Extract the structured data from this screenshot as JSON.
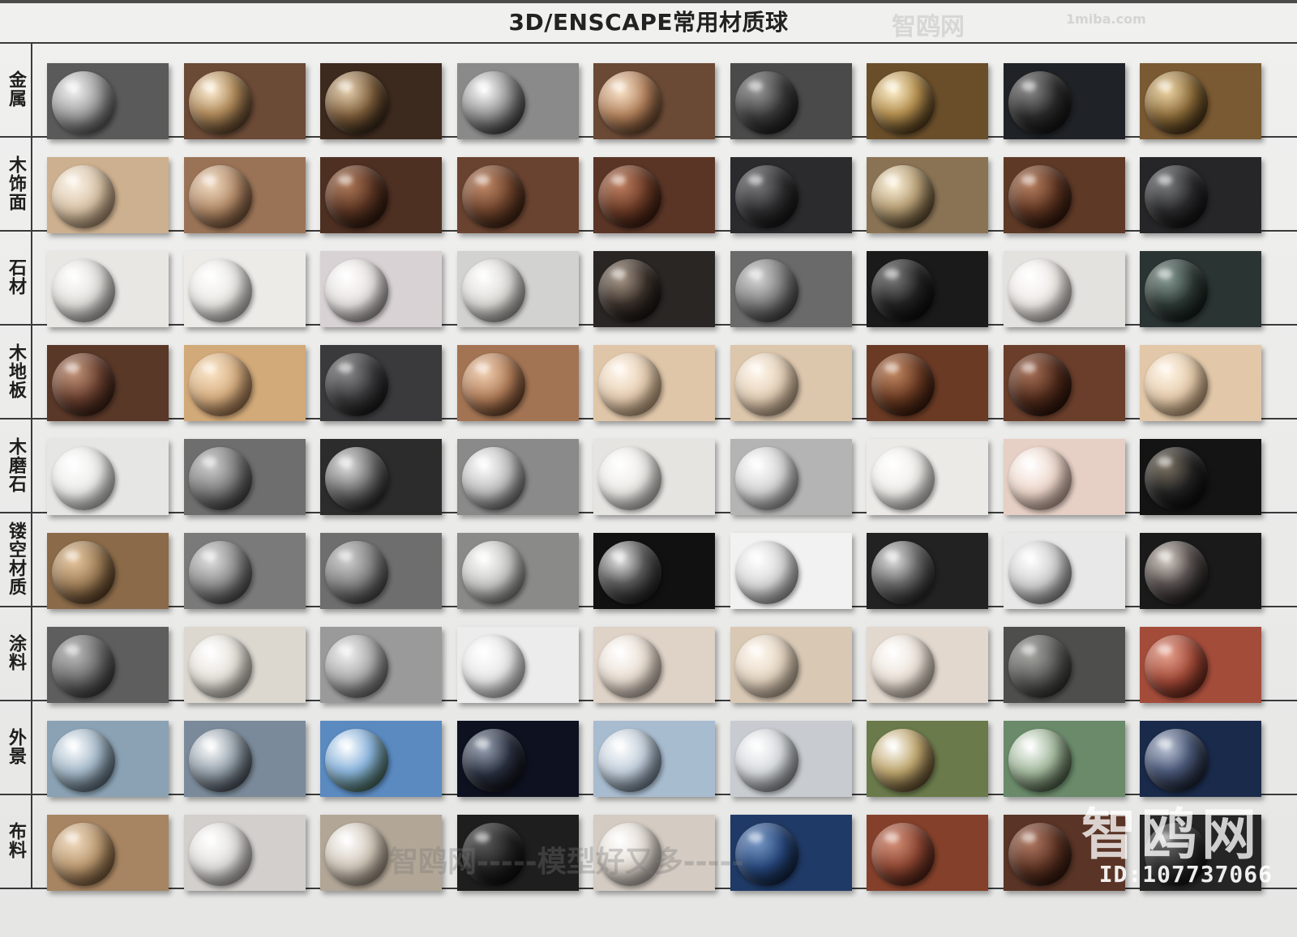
{
  "title": "3D/ENSCAPE常用材质球",
  "rows": [
    {
      "label": "金属",
      "name": "metal",
      "tiles": [
        {
          "bg": "#5a5a5a",
          "ball": "radial-gradient(circle at 35% 30%, #f4f4f4, #9a9a9a 45%, #3a3a3a 90%)"
        },
        {
          "bg": "#6b4a36",
          "ball": "radial-gradient(circle at 35% 30%, #fff1d8, #b08a5a 40%, #3a2718 90%)"
        },
        {
          "bg": "#3d2a1e",
          "ball": "radial-gradient(circle at 35% 30%, #e8d2b0, #7a5a38 45%, #1a120a 90%)"
        },
        {
          "bg": "#8a8a8a",
          "ball": "radial-gradient(circle at 35% 30%, #ffffff, #9a9a9a 40%, #222 90%)"
        },
        {
          "bg": "#6b4a35",
          "ball": "radial-gradient(circle at 35% 30%, #fbe6cd, #b07e58 45%, #4a2e1c 90%)"
        },
        {
          "bg": "#4a4a4a",
          "ball": "radial-gradient(circle at 35% 30%, #9a9a9a, #3a3a3a 45%, #111 90%)"
        },
        {
          "bg": "#6a4e2a",
          "ball": "radial-gradient(circle at 35% 30%, #fff3d0, #b59050 40%, #2a1a0a 90%)"
        },
        {
          "bg": "#1f2226",
          "ball": "radial-gradient(circle at 35% 30%, #8a8a8a, #2a2a2a 45%, #0a0a0a 90%)"
        },
        {
          "bg": "#7a5a32",
          "ball": "radial-gradient(circle at 35% 30%, #f0d8a8, #8a6a38 45%, #2a1a08 90%)"
        }
      ]
    },
    {
      "label": "木饰面",
      "name": "wood-veneer",
      "tiles": [
        {
          "bg": "#cdb08f",
          "ball": "radial-gradient(circle at 35% 30%, #fbf3e8, #d9c3a6 45%, #8a6e50 90%)"
        },
        {
          "bg": "#9a7356",
          "ball": "radial-gradient(circle at 35% 30%, #f2dcc2, #b08866 45%, #5a3a24 90%)"
        },
        {
          "bg": "#4e3022",
          "ball": "radial-gradient(circle at 35% 30%, #b07a58, #5a3422 45%, #1e0e06 90%)"
        },
        {
          "bg": "#6a4330",
          "ball": "radial-gradient(circle at 35% 30%, #c28a68, #6e432c 45%, #2a150a 90%)"
        },
        {
          "bg": "#5a3526",
          "ball": "radial-gradient(circle at 35% 30%, #c08060, #6a3a26 45%, #250f06 90%)"
        },
        {
          "bg": "#2b2b2d",
          "ball": "radial-gradient(circle at 35% 30%, #7a7a7c, #2e2e30 45%, #0a0a0a 90%)"
        },
        {
          "bg": "#8a7354",
          "ball": "radial-gradient(circle at 35% 30%, #fff6e0, #b9a178 40%, #3a2a14 90%)"
        },
        {
          "bg": "#5e3926",
          "ball": "radial-gradient(circle at 35% 30%, #b98060, #5e3522 45%, #200c04 90%)"
        },
        {
          "bg": "#262628",
          "ball": "radial-gradient(circle at 35% 30%, #7a7c7e, #2a2a2c 45%, #080808 90%)"
        }
      ]
    },
    {
      "label": "石材",
      "name": "stone",
      "tiles": [
        {
          "bg": "#e9e7e4",
          "ball": "radial-gradient(circle at 35% 30%, #ffffff, #e2e0dc 45%, #8a8885 90%)"
        },
        {
          "bg": "#ecebe8",
          "ball": "radial-gradient(circle at 35% 30%, #ffffff, #eae8e4 45%, #9a9894 90%)"
        },
        {
          "bg": "#d9d2d4",
          "ball": "radial-gradient(circle at 35% 30%, #ffffff, #e6e2e0 45%, #7a7474 90%)"
        },
        {
          "bg": "#d2d2d0",
          "ball": "radial-gradient(circle at 35% 30%, #ffffff, #dcdad6 45%, #7a7874 90%)"
        },
        {
          "bg": "#2a2624",
          "ball": "radial-gradient(circle at 35% 30%, #a89888, #3a302a 45%, #0a0806 90%)"
        },
        {
          "bg": "#6a6a6a",
          "ball": "radial-gradient(circle at 35% 30%, #d8d8d8, #7a7a7a 45%, #2a2a2a 90%)"
        },
        {
          "bg": "#1a1a1a",
          "ball": "radial-gradient(circle at 35% 30%, #7a7a7a, #222 45%, #050505 90%)"
        },
        {
          "bg": "#e4e2df",
          "ball": "radial-gradient(circle at 35% 30%, #ffffff, #eeeae6 45%, #9a9690 90%)"
        },
        {
          "bg": "#2a3432",
          "ball": "radial-gradient(circle at 35% 30%, #8a9e98, #2e3a36 45%, #0a100e 90%)"
        }
      ]
    },
    {
      "label": "木地板",
      "name": "wood-floor",
      "tiles": [
        {
          "bg": "#5a3828",
          "ball": "radial-gradient(circle at 35% 30%, #c4967a, #6a4030 45%, #24120a 90%)"
        },
        {
          "bg": "#d2a978",
          "ball": "radial-gradient(circle at 35% 30%, #fbe6c8, #d6ad80 45%, #7a5434 90%)"
        },
        {
          "bg": "#3a3a3c",
          "ball": "radial-gradient(circle at 35% 30%, #8a8a8c, #3a3a3c 45%, #0c0c0c 90%)"
        },
        {
          "bg": "#a37453",
          "ball": "radial-gradient(circle at 35% 30%, #f2d2b4, #b07c58 45%, #4a2a16 90%)"
        },
        {
          "bg": "#e0c6a8",
          "ball": "radial-gradient(circle at 35% 30%, #fff8ee, #e6cdb0 45%, #9a7c5c 90%)"
        },
        {
          "bg": "#dcc6ac",
          "ball": "radial-gradient(circle at 35% 30%, #fff8ee, #e4cfb6 45%, #9a8066 90%)"
        },
        {
          "bg": "#6a3a24",
          "ball": "radial-gradient(circle at 35% 30%, #c48a64, #6a3a22 45%, #220c04 90%)"
        },
        {
          "bg": "#6a3e2a",
          "ball": "radial-gradient(circle at 35% 30%, #a87058, #522c1c 45%, #1a0804 90%)"
        },
        {
          "bg": "#e2c8a8",
          "ball": "radial-gradient(circle at 35% 30%, #fff6e8, #e6ccac 45%, #9a7a56 90%)"
        }
      ]
    },
    {
      "label": "木磨石",
      "name": "terrazzo",
      "tiles": [
        {
          "bg": "#e6e6e4",
          "ball": "radial-gradient(circle at 35% 30%, #ffffff, #ececea 45%, #9a9a98 90%)"
        },
        {
          "bg": "#6e6e6e",
          "ball": "radial-gradient(circle at 35% 30%, #cfcfcf, #7a7a7a 45%, #2a2a2a 90%)"
        },
        {
          "bg": "#2c2c2c",
          "ball": "radial-gradient(circle at 35% 30%, #e0e0e0, #6a6a6a 45%, #111 90%)"
        },
        {
          "bg": "#8a8a8a",
          "ball": "radial-gradient(circle at 35% 30%, #ffffff, #bdbdbd 45%, #4a4a4a 90%)"
        },
        {
          "bg": "#e6e4e0",
          "ball": "radial-gradient(circle at 35% 30%, #ffffff, #eceae6 45%, #9a9894 90%)"
        },
        {
          "bg": "#b4b4b4",
          "ball": "radial-gradient(circle at 35% 30%, #ffffff, #d4d4d4 45%, #7a7a7a 90%)"
        },
        {
          "bg": "#eceae6",
          "ball": "radial-gradient(circle at 35% 30%, #ffffff, #f0eeea 45%, #a09e9a 90%)"
        },
        {
          "bg": "#e6cfc4",
          "ball": "radial-gradient(circle at 35% 30%, #ffffff, #efd8cc 45%, #a08478 90%)"
        },
        {
          "bg": "#141414",
          "ball": "radial-gradient(circle at 35% 30%, #7a7060, #222 45%, #050505 90%)"
        }
      ]
    },
    {
      "label": "镂空材质",
      "name": "perforated",
      "tiles": [
        {
          "bg": "#8a6a48",
          "ball": "radial-gradient(circle at 35% 30%, #e8c8a0, #9a7a54 45%, #3a2410 90%)"
        },
        {
          "bg": "#7a7a7a",
          "ball": "radial-gradient(circle at 35% 30%, #e0e0e0, #8a8a8a 45%, #303030 90%)"
        },
        {
          "bg": "#6e6e6e",
          "ball": "radial-gradient(circle at 35% 30%, #cfcfcf, #7e7e7e 45%, #2c2c2c 90%)"
        },
        {
          "bg": "#8a8a88",
          "ball": "radial-gradient(circle at 35% 30%, #ffffff, #c4c4c2 45%, #5a5a58 90%)"
        },
        {
          "bg": "#111111",
          "ball": "radial-gradient(circle at 35% 30%, #e8e8e8, #5a5a5a 40%, #0a0a0a 90%)"
        },
        {
          "bg": "#f2f2f2",
          "ball": "radial-gradient(circle at 35% 30%, #ffffff, #d8d8d8 45%, #7a7a7a 90%)"
        },
        {
          "bg": "#222222",
          "ball": "radial-gradient(circle at 35% 30%, #e0e0e0, #6a6a6a 40%, #111 90%)"
        },
        {
          "bg": "#e8e8e8",
          "ball": "radial-gradient(circle at 35% 30%, #ffffff, #cfcfcf 45%, #6a6a6a 90%)"
        },
        {
          "bg": "#1a1a1a",
          "ball": "radial-gradient(circle at 35% 30%, #d8d0c8, #5a5250 40%, #0a0a0a 90%)"
        }
      ]
    },
    {
      "label": "涂料",
      "name": "paint",
      "tiles": [
        {
          "bg": "#5e5e5e",
          "ball": "radial-gradient(circle at 35% 30%, #bdbdbd, #6a6a6a 45%, #262626 90%)"
        },
        {
          "bg": "#dcd8d0",
          "ball": "radial-gradient(circle at 35% 30%, #ffffff, #e6e2da 45%, #9a968e 90%)"
        },
        {
          "bg": "#9a9a9a",
          "ball": "radial-gradient(circle at 35% 30%, #f0f0f0, #aaaaaa 45%, #4a4a4a 90%)"
        },
        {
          "bg": "#ececec",
          "ball": "radial-gradient(circle at 35% 30%, #ffffff, #e8e8e8 45%, #9a9a9a 90%)"
        },
        {
          "bg": "#dfd2c6",
          "ball": "radial-gradient(circle at 35% 30%, #ffffff, #eaded2 45%, #a0948a 90%)"
        },
        {
          "bg": "#d8c8b4",
          "ball": "radial-gradient(circle at 35% 30%, #fffaf2, #e4d4c0 45%, #9a8a76 90%)"
        },
        {
          "bg": "#e2d8ce",
          "ball": "radial-gradient(circle at 35% 30%, #ffffff, #ece2d8 45%, #a09688 90%)"
        },
        {
          "bg": "#4e4e4c",
          "ball": "radial-gradient(circle at 35% 30%, #a8a8a4, #5a5a58 45%, #1e1e1e 90%)"
        },
        {
          "bg": "#a44c3a",
          "ball": "radial-gradient(circle at 35% 30%, #e8a490, #a24a38 45%, #4a160c 90%)"
        }
      ]
    },
    {
      "label": "外景",
      "name": "exterior",
      "tiles": [
        {
          "bg": "#8aa2b4",
          "ball": "radial-gradient(circle at 35% 30%, #ffffff, #a8bccc 40%, #3a4a56 90%)"
        },
        {
          "bg": "#7a8a9a",
          "ball": "radial-gradient(circle at 35% 30%, #ffffff, #9aa6b0 40%, #2a3038 90%)"
        },
        {
          "bg": "#5a8ac0",
          "ball": "radial-gradient(circle at 35% 30%, #ffffff, #8ab4dc 40%, #2a4a2a 90%)"
        },
        {
          "bg": "#0e1220",
          "ball": "radial-gradient(circle at 35% 30%, #9aa4b4, #2a3040 45%, #05060a 90%)"
        },
        {
          "bg": "#a8bcd0",
          "ball": "radial-gradient(circle at 35% 30%, #ffffff, #c4d0dc 40%, #4a5a6a 90%)"
        },
        {
          "bg": "#c8ccd0",
          "ball": "radial-gradient(circle at 35% 30%, #ffffff, #d8dcdf 40%, #6a6e72 90%)"
        },
        {
          "bg": "#6a7a4a",
          "ball": "radial-gradient(circle at 35% 30%, #ffffff, #c0a870 40%, #3a2a14 90%)"
        },
        {
          "bg": "#6a8a6a",
          "ball": "radial-gradient(circle at 35% 30%, #ffffff, #a6bca0 40%, #2a3a24 90%)"
        },
        {
          "bg": "#1a2a4a",
          "ball": "radial-gradient(circle at 35% 30%, #c0c8d8, #4a5878 40%, #0a0e18 90%)"
        }
      ]
    },
    {
      "label": "布料",
      "name": "fabric",
      "tiles": [
        {
          "bg": "#a78562",
          "ball": "radial-gradient(circle at 35% 30%, #f2dcc0, #b8966e 45%, #5a3e22 90%)"
        },
        {
          "bg": "#d2cfcc",
          "ball": "radial-gradient(circle at 35% 30%, #ffffff, #e0dedb 45%, #8e8c88 90%)"
        },
        {
          "bg": "#b2a696",
          "ball": "radial-gradient(circle at 35% 30%, #ffffff, #d0c6b8 45%, #7a6e60 90%)"
        },
        {
          "bg": "#1e1e1e",
          "ball": "radial-gradient(circle at 35% 30%, #5a5a5a, #222 45%, #050505 90%)"
        },
        {
          "bg": "#d4cbc2",
          "ball": "radial-gradient(circle at 35% 30%, #ffffff, #e2dad2 45%, #968e86 90%)"
        },
        {
          "bg": "#1f3a66",
          "ball": "radial-gradient(circle at 35% 30%, #7a9ac8, #26467a 45%, #0a1426 90%)"
        },
        {
          "bg": "#84402a",
          "ball": "radial-gradient(circle at 35% 30%, #d6927a, #8a4430 45%, #32120a 90%)"
        },
        {
          "bg": "#5a3426",
          "ball": "radial-gradient(circle at 35% 30%, #b27a64, #5e3424 45%, #1e0a04 90%)"
        },
        {
          "bg": "#252525",
          "ball": "radial-gradient(circle at 35% 30%, #6a6a6a, #2a2a2a 45%, #080808 90%)"
        }
      ]
    }
  ],
  "watermarks": {
    "brand": "智鸥网",
    "slogan": "智鸥网-----模型好又多-----",
    "site": "1miba.com",
    "id": "ID:107737066"
  }
}
